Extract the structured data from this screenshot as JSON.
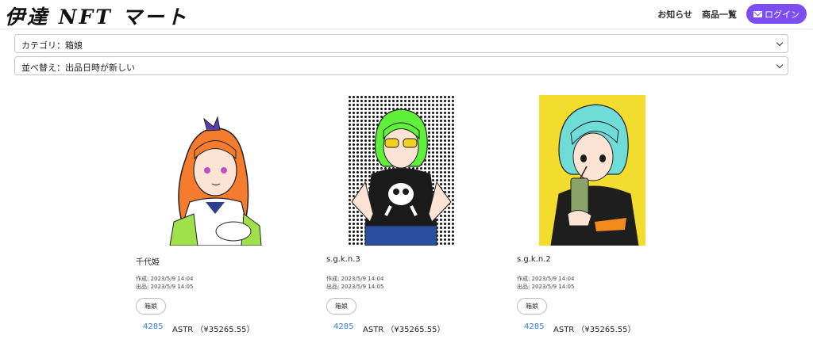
{
  "header": {
    "logo": "伊達 NFT マート",
    "nav": {
      "news": "お知らせ",
      "products": "商品一覧",
      "login": "ログイン"
    }
  },
  "filters": {
    "category": "カテゴリ：箱娘",
    "sort": "並べ替え：出品日時が新しい"
  },
  "products": [
    {
      "title": "千代姫",
      "created": "作成: 2023/5/9 14:04",
      "listed": "出品: 2023/5/9 14:05",
      "tag": "箱娘",
      "price": "4285",
      "currency": "ASTR （¥35265.55）"
    },
    {
      "title": "s.g.k.n.3",
      "created": "作成: 2023/5/9 14:04",
      "listed": "出品: 2023/5/9 14:05",
      "tag": "箱娘",
      "price": "4285",
      "currency": "ASTR （¥35265.55）"
    },
    {
      "title": "s.g.k.n.2",
      "created": "作成: 2023/5/9 14:04",
      "listed": "出品: 2023/5/9 14:05",
      "tag": "箱娘",
      "price": "4285",
      "currency": "ASTR （¥35265.55）"
    }
  ],
  "colors": {
    "accent": "#7b4df2",
    "price": "#3478f6",
    "yellow_bg": "#f2dc2e",
    "green_hair": "#5ef03a",
    "cyan_hair": "#6fdcd8",
    "orange_hair": "#f57b2e"
  }
}
